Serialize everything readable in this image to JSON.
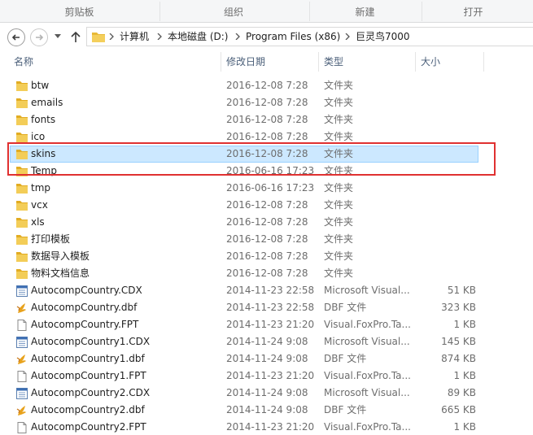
{
  "ribbon": {
    "groups": [
      "剪贴板",
      "组织",
      "新建",
      "打开"
    ]
  },
  "nav": {
    "back_icon": "back-arrow-icon",
    "forward_icon": "forward-arrow-icon",
    "breadcrumb": [
      "计算机",
      "本地磁盘 (D:)",
      "Program Files (x86)",
      "巨灵鸟7000"
    ]
  },
  "columns": {
    "name": "名称",
    "date": "修改日期",
    "type": "类型",
    "size": "大小"
  },
  "files": [
    {
      "name": "btw",
      "date": "2016-12-08 7:28",
      "type": "文件夹",
      "size": "",
      "icon": "folder"
    },
    {
      "name": "emails",
      "date": "2016-12-08 7:28",
      "type": "文件夹",
      "size": "",
      "icon": "folder"
    },
    {
      "name": "fonts",
      "date": "2016-12-08 7:28",
      "type": "文件夹",
      "size": "",
      "icon": "folder"
    },
    {
      "name": "ico",
      "date": "2016-12-08 7:28",
      "type": "文件夹",
      "size": "",
      "icon": "folder"
    },
    {
      "name": "skins",
      "date": "2016-12-08 7:28",
      "type": "文件夹",
      "size": "",
      "icon": "folder",
      "selected": true
    },
    {
      "name": "Temp",
      "date": "2016-06-16 17:23",
      "type": "文件夹",
      "size": "",
      "icon": "folder"
    },
    {
      "name": "tmp",
      "date": "2016-06-16 17:23",
      "type": "文件夹",
      "size": "",
      "icon": "folder"
    },
    {
      "name": "vcx",
      "date": "2016-12-08 7:28",
      "type": "文件夹",
      "size": "",
      "icon": "folder"
    },
    {
      "name": "xls",
      "date": "2016-12-08 7:28",
      "type": "文件夹",
      "size": "",
      "icon": "folder"
    },
    {
      "name": "打印模板",
      "date": "2016-12-08 7:28",
      "type": "文件夹",
      "size": "",
      "icon": "folder"
    },
    {
      "name": "数据导入模板",
      "date": "2016-12-08 7:28",
      "type": "文件夹",
      "size": "",
      "icon": "folder"
    },
    {
      "name": "物料文档信息",
      "date": "2016-12-08 7:28",
      "type": "文件夹",
      "size": "",
      "icon": "folder"
    },
    {
      "name": "AutocompCountry.CDX",
      "date": "2014-11-23 22:58",
      "type": "Microsoft Visual...",
      "size": "51 KB",
      "icon": "cdx"
    },
    {
      "name": "AutocompCountry.dbf",
      "date": "2014-11-23 22:58",
      "type": "DBF 文件",
      "size": "323 KB",
      "icon": "dbf"
    },
    {
      "name": "AutocompCountry.FPT",
      "date": "2014-11-23 21:20",
      "type": "Visual.FoxPro.Ta...",
      "size": "1 KB",
      "icon": "file"
    },
    {
      "name": "AutocompCountry1.CDX",
      "date": "2014-11-24 9:08",
      "type": "Microsoft Visual...",
      "size": "145 KB",
      "icon": "cdx"
    },
    {
      "name": "AutocompCountry1.dbf",
      "date": "2014-11-24 9:08",
      "type": "DBF 文件",
      "size": "874 KB",
      "icon": "dbf"
    },
    {
      "name": "AutocompCountry1.FPT",
      "date": "2014-11-23 21:20",
      "type": "Visual.FoxPro.Ta...",
      "size": "1 KB",
      "icon": "file"
    },
    {
      "name": "AutocompCountry2.CDX",
      "date": "2014-11-24 9:08",
      "type": "Microsoft Visual...",
      "size": "89 KB",
      "icon": "cdx"
    },
    {
      "name": "AutocompCountry2.dbf",
      "date": "2014-11-24 9:08",
      "type": "DBF 文件",
      "size": "665 KB",
      "icon": "dbf"
    },
    {
      "name": "AutocompCountry2.FPT",
      "date": "2014-11-23 21:20",
      "type": "Visual.FoxPro.Ta...",
      "size": "1 KB",
      "icon": "file"
    }
  ],
  "colors": {
    "selection": "#cce8ff",
    "selection_border": "#99d1ff",
    "highlight": "#e03131",
    "folder": "#f0c84a"
  }
}
